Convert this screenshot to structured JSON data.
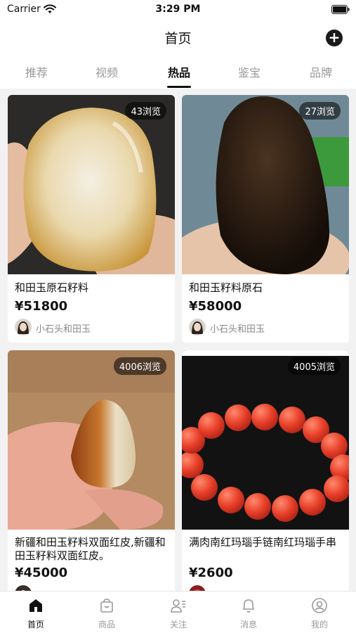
{
  "status": {
    "carrier": "Carrier",
    "time": "3:29 PM"
  },
  "header": {
    "title": "首页"
  },
  "tabs": [
    "推荐",
    "视频",
    "热品",
    "鉴宝",
    "品牌"
  ],
  "active_tab": "热品",
  "products": [
    {
      "views": "43浏览",
      "title": "和田玉原石籽料",
      "price": "¥51800",
      "seller": "小石头和田玉"
    },
    {
      "views": "27浏览",
      "title": "和田玉籽料原石",
      "price": "¥58000",
      "seller": "小石头和田玉"
    },
    {
      "views": "4006浏览",
      "title": "新疆和田玉籽料双面红皮,新疆和田玉籽料双面红皮。",
      "price": "¥45000",
      "seller": ""
    },
    {
      "views": "4005浏览",
      "title": "满肉南红玛瑙手链南红玛瑙手串",
      "price": "¥2600",
      "seller": ""
    }
  ],
  "bottom_nav": [
    {
      "label": "首页",
      "icon": "home-icon"
    },
    {
      "label": "商品",
      "icon": "shopping-bag-icon"
    },
    {
      "label": "关注",
      "icon": "follow-user-icon"
    },
    {
      "label": "消息",
      "icon": "bell-icon"
    },
    {
      "label": "我的",
      "icon": "profile-icon"
    }
  ],
  "active_nav": "首页",
  "colors": {
    "accent": "#111111",
    "inactive": "#999999",
    "background": "#f2f2f2"
  }
}
